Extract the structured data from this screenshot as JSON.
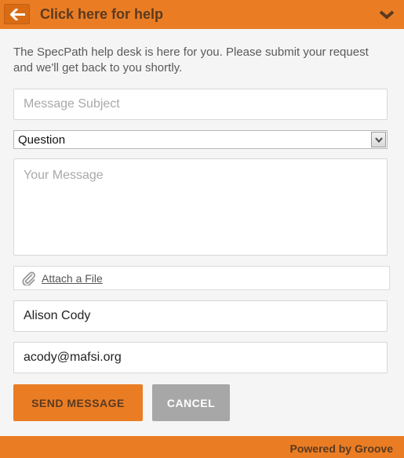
{
  "header": {
    "title": "Click here for help",
    "back_icon": "arrow-left-icon",
    "collapse_icon": "chevron-down-icon"
  },
  "intro": {
    "text": "The SpecPath help desk is here for you. Please submit your request and we'll get back to you shortly."
  },
  "form": {
    "subject": {
      "placeholder": "Message Subject",
      "value": ""
    },
    "type_select": {
      "selected": "Question"
    },
    "message": {
      "placeholder": "Your Message",
      "value": ""
    },
    "attach": {
      "label": "Attach a File",
      "icon": "paperclip-icon"
    },
    "name": {
      "value": "Alison Cody"
    },
    "email": {
      "value": "acody@mafsi.org"
    }
  },
  "buttons": {
    "send": "SEND MESSAGE",
    "cancel": "CANCEL"
  },
  "footer": {
    "powered_by": "Powered by Groove"
  },
  "colors": {
    "accent": "#ea7d24",
    "accent_text": "#5b3a20",
    "cancel_bg": "#a7a7a7",
    "background": "#f5f5f5"
  }
}
